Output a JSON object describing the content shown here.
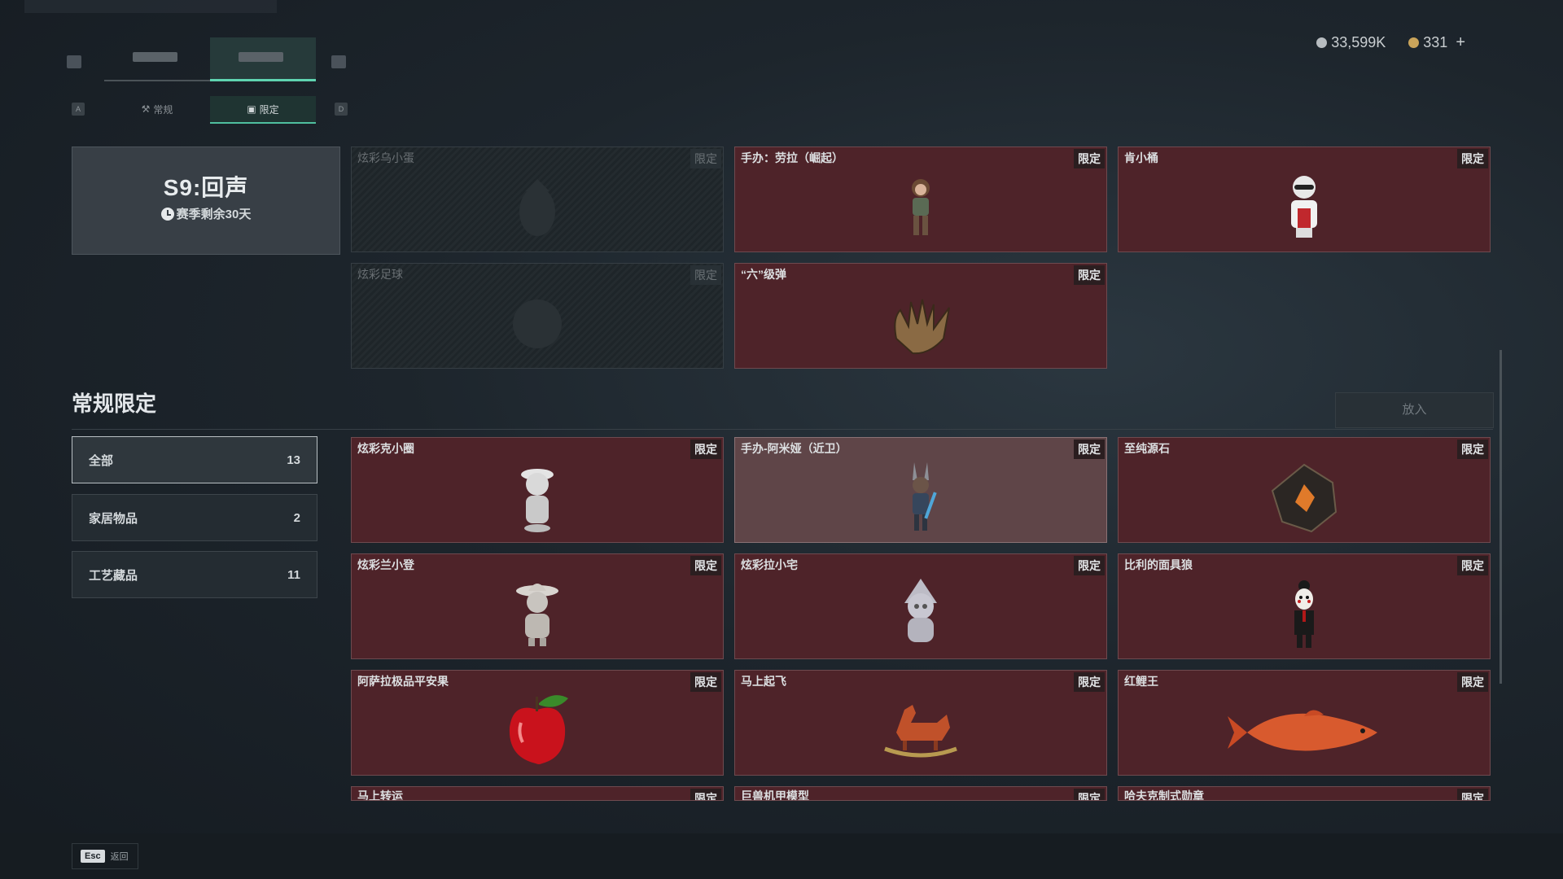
{
  "currency": {
    "silver": "33,599K",
    "gold": "331",
    "add": "+"
  },
  "sub_tabs": {
    "normal": "常规",
    "limited": "限定",
    "left_key": "A",
    "right_key": "D"
  },
  "season": {
    "title": "S9:回声",
    "remaining": "赛季剩余30天"
  },
  "badge_label": "限定",
  "season_items": [
    {
      "name": "炫彩乌小蛋",
      "locked": true,
      "icon": "egg-figure-icon"
    },
    {
      "name": "手办：劳拉（崛起）",
      "locked": false,
      "icon": "lara-figure-icon"
    },
    {
      "name": "肯小桶",
      "locked": false,
      "icon": "colonel-figure-icon"
    },
    {
      "name": "炫彩足球",
      "locked": true,
      "icon": "football-icon"
    },
    {
      "name": "“六”级弹",
      "locked": false,
      "icon": "bullet-hand-icon"
    }
  ],
  "section": {
    "title": "常规限定",
    "put_button": "放入"
  },
  "categories": [
    {
      "label": "全部",
      "count": "13"
    },
    {
      "label": "家居物品",
      "count": "2"
    },
    {
      "label": "工艺藏品",
      "count": "11"
    }
  ],
  "items": [
    {
      "name": "炫彩克小圈",
      "icon": "kitty-figure-icon"
    },
    {
      "name": "手办-阿米娅（近卫）",
      "icon": "amiya-figure-icon"
    },
    {
      "name": "至纯源石",
      "icon": "originium-icon"
    },
    {
      "name": "炫彩兰小登",
      "icon": "sombrero-figure-icon"
    },
    {
      "name": "炫彩拉小宅",
      "icon": "hooded-figure-icon"
    },
    {
      "name": "比利的面具狼",
      "icon": "billy-puppet-icon"
    },
    {
      "name": "阿萨拉极品平安果",
      "icon": "apple-icon"
    },
    {
      "name": "马上起飞",
      "icon": "rocking-horse-icon"
    },
    {
      "name": "红鲤王",
      "icon": "carp-icon"
    },
    {
      "name": "马上转运",
      "icon": "partial-card-icon"
    },
    {
      "name": "巨兽机甲模型",
      "icon": "partial-card-icon"
    },
    {
      "name": "哈夫克制式勋章",
      "icon": "partial-card-icon"
    }
  ],
  "footer": {
    "esc_key": "Esc",
    "back": "返回"
  },
  "colors": {
    "accent": "#5fd3b0",
    "card_bg": "#4e2329",
    "badge_bg": "#2b1e20"
  }
}
